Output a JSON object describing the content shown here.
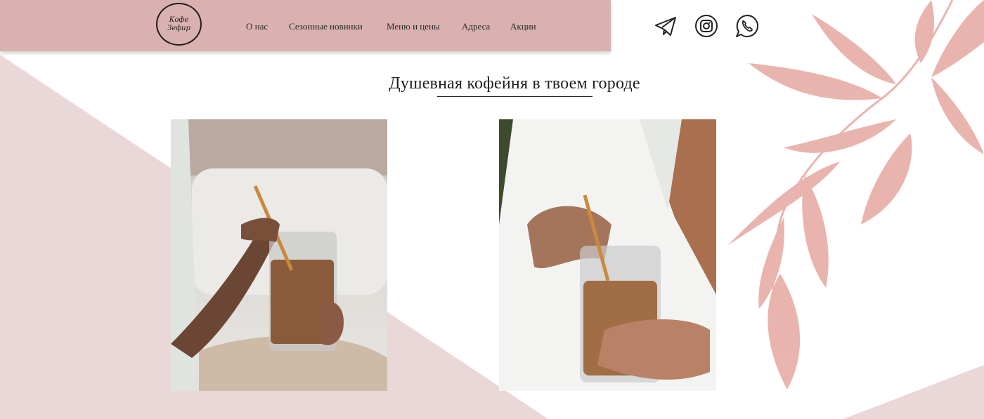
{
  "logo": {
    "line1": "Кофе",
    "line2": "Зефир"
  },
  "nav": {
    "items": [
      {
        "label": "О нас"
      },
      {
        "label": "Сезонные новинки"
      },
      {
        "label": "Меню и цены"
      },
      {
        "label": "Адреса"
      },
      {
        "label": "Акции"
      }
    ]
  },
  "social": {
    "icons": [
      "telegram-icon",
      "instagram-icon",
      "whatsapp-icon"
    ]
  },
  "main": {
    "title": "Душевная кофейня в твоем городе"
  },
  "colors": {
    "header_bg": "#d9b1b0",
    "bg_pink": "#ead7d8",
    "leaf": "#e8a9a2"
  }
}
